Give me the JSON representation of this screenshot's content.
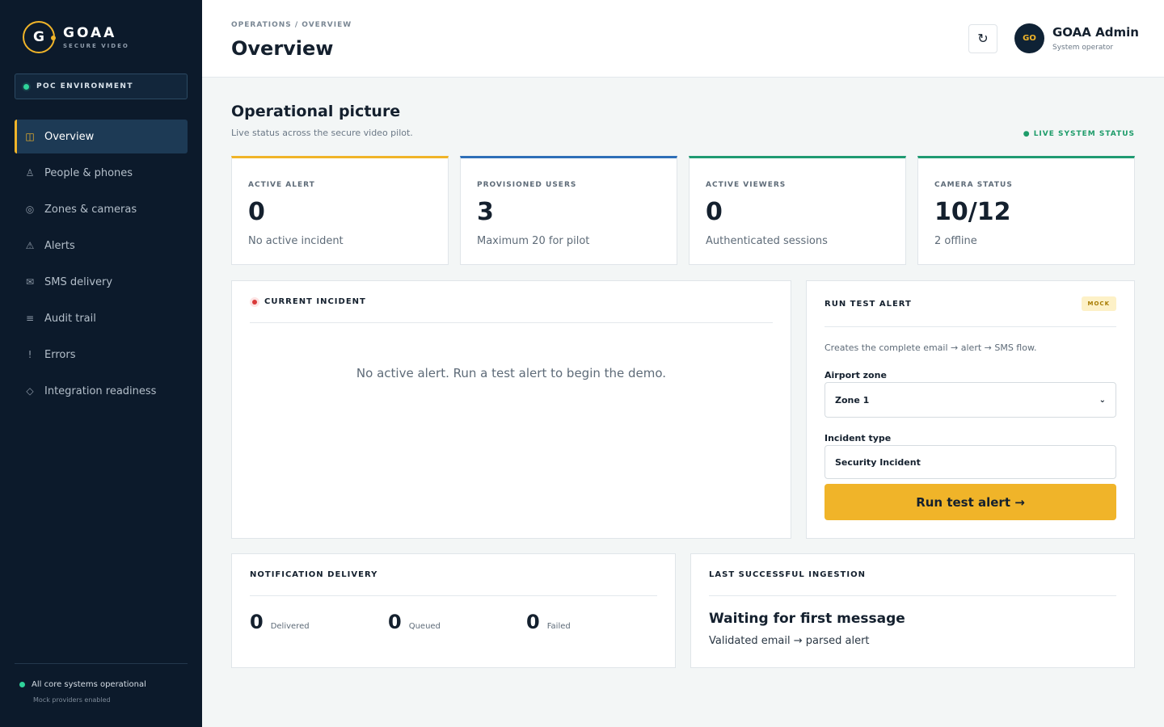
{
  "brand": {
    "name": "GOAA",
    "subtitle": "SECURE VIDEO",
    "logo_letter": "G"
  },
  "environment": {
    "label": "POC ENVIRONMENT"
  },
  "nav": {
    "items": [
      {
        "label": "Overview",
        "icon": "◫",
        "icon_name": "overview-icon",
        "active": true
      },
      {
        "label": "People & phones",
        "icon": "♙",
        "icon_name": "person-icon"
      },
      {
        "label": "Zones & cameras",
        "icon": "◎",
        "icon_name": "camera-icon"
      },
      {
        "label": "Alerts",
        "icon": "⚠",
        "icon_name": "warning-icon"
      },
      {
        "label": "SMS delivery",
        "icon": "✉",
        "icon_name": "envelope-icon"
      },
      {
        "label": "Audit trail",
        "icon": "≡",
        "icon_name": "list-icon"
      },
      {
        "label": "Errors",
        "icon": "!",
        "icon_name": "error-icon"
      },
      {
        "label": "Integration readiness",
        "icon": "◇",
        "icon_name": "diamond-icon"
      }
    ]
  },
  "sidebar_footer": {
    "status": "All core systems operational",
    "note": "Mock providers enabled"
  },
  "header": {
    "breadcrumb": "OPERATIONS / OVERVIEW",
    "title": "Overview",
    "refresh_icon": "↻",
    "user": {
      "initials": "GO",
      "name": "GOAA Admin",
      "role": "System operator"
    }
  },
  "section": {
    "title": "Operational picture",
    "subtitle": "Live status across the secure video pilot.",
    "live_status": "● LIVE SYSTEM STATUS"
  },
  "stats": [
    {
      "label": "ACTIVE ALERT",
      "value": "0",
      "desc": "No active incident",
      "accent": "#f0b429"
    },
    {
      "label": "PROVISIONED USERS",
      "value": "3",
      "desc": "Maximum 20 for pilot",
      "accent": "#2e6fb8"
    },
    {
      "label": "ACTIVE VIEWERS",
      "value": "0",
      "desc": "Authenticated sessions",
      "accent": "#1f9a72"
    },
    {
      "label": "CAMERA STATUS",
      "value": "10/12",
      "desc": "2 offline",
      "accent": "#1f9a72"
    }
  ],
  "incident": {
    "title": "CURRENT INCIDENT",
    "empty_message": "No active alert. Run a test alert to begin the demo."
  },
  "test_alert": {
    "title": "RUN TEST ALERT",
    "tag": "MOCK",
    "description": "Creates the complete email → alert → SMS flow.",
    "zone_label": "Airport zone",
    "zone_value": "Zone 1",
    "type_label": "Incident type",
    "type_value": "Security Incident",
    "button": "Run test alert →"
  },
  "delivery": {
    "title": "NOTIFICATION DELIVERY",
    "stats": [
      {
        "value": "0",
        "label": "Delivered"
      },
      {
        "value": "0",
        "label": "Queued"
      },
      {
        "value": "0",
        "label": "Failed"
      }
    ]
  },
  "ingestion": {
    "title": "LAST SUCCESSFUL INGESTION",
    "headline": "Waiting for first message",
    "sub": "Validated email → parsed alert"
  },
  "colors": {
    "sidebar": "#0c1a2b",
    "accent": "#f0b429",
    "success": "#2fd39a",
    "danger": "#d93a3a"
  }
}
